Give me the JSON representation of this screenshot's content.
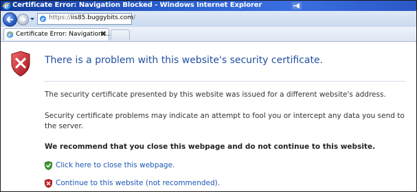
{
  "window": {
    "title": "Certificate Error: Navigation Blocked - Windows Internet Explorer"
  },
  "address_bar": {
    "url_prefix": "https://",
    "url_host": "iis85.buggybits.com",
    "url_suffix": "/"
  },
  "tabs": [
    {
      "label": "Certificate Error: Navigation ...",
      "close": "✖"
    }
  ],
  "page": {
    "heading": "There is a problem with this website's security certificate.",
    "paragraph1": "The security certificate presented by this website was issued for a different website's address.",
    "paragraph2": "Security certificate problems may indicate an attempt to fool you or intercept any data you send to the server.",
    "recommendation": "We recommend that you close this webpage and do not continue to this website.",
    "close_link": "Click here to close this webpage.",
    "continue_link": "Continue to this website (not recommended)."
  },
  "colors": {
    "titlebar": "#2a5fd0",
    "heading": "#1f4e9e",
    "link": "#1a55b3",
    "error_red": "#c8232c",
    "ok_green": "#3c9a2e"
  },
  "icons": {
    "title": "ie-icon",
    "pin": "pushpin-icon",
    "back": "back-arrow-icon",
    "forward": "forward-arrow-icon",
    "error": "shield-error-icon",
    "safe": "shield-check-icon",
    "warn": "shield-x-icon"
  }
}
